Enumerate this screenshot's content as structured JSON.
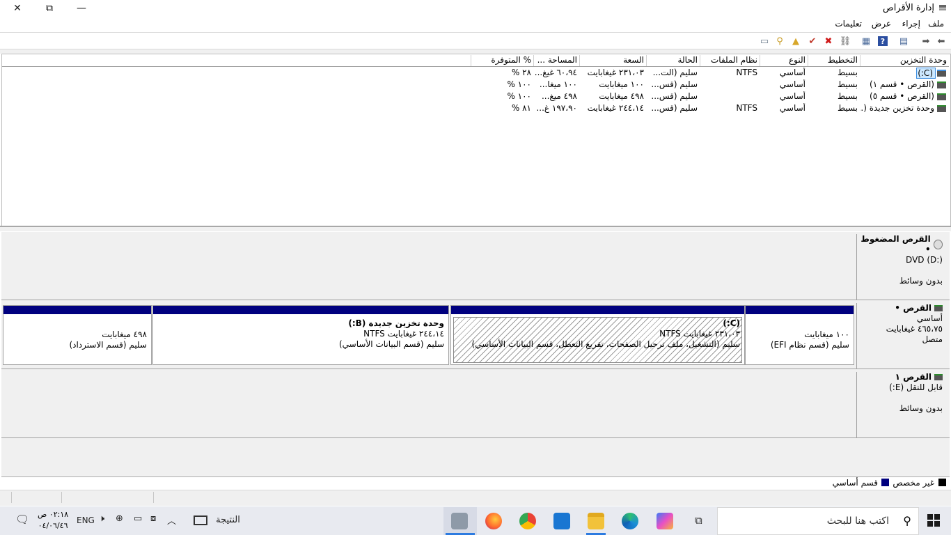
{
  "window": {
    "title": "إدارة الأقراص",
    "icon": "disk-management-icon",
    "controls": {
      "minimize": "—",
      "restore": "⧉",
      "close": "✕"
    }
  },
  "menu": [
    "ملف",
    "إجراء",
    "عرض",
    "تعليمات"
  ],
  "toolbar": [
    "back-icon",
    "forward-icon",
    "properties-icon",
    "help-icon",
    "show-hide-icon",
    "connect-icon",
    "delete-icon",
    "check-icon",
    "folder-up-icon",
    "search-icon",
    "console-icon"
  ],
  "volume_list": {
    "columns": [
      "وحدة التخزين",
      "التخطيط",
      "النوع",
      "نظام الملفات",
      "الحالة",
      "السعة",
      "المساحة ...",
      "% المتوفرة"
    ],
    "rows": [
      [
        "(C:)",
        "بسيط",
        "أساسي",
        "NTFS",
        "سليم (الت...",
        "٢٣١،٠٣ غيغابايت",
        "٦٠،٩٤ غيغ...",
        "٢٨ %"
      ],
      [
        "(القرص • قسم ١)",
        "بسيط",
        "أساسي",
        "",
        "سليم (قس...",
        "١٠٠ ميغابايت",
        "١٠٠ ميغا...",
        "١٠٠ %"
      ],
      [
        "(القرص • قسم ٥)",
        "بسيط",
        "أساسي",
        "",
        "سليم (قس...",
        "٤٩٨ ميغابايت",
        "٤٩٨ ميغ...",
        "١٠٠ %"
      ],
      [
        "وحدة تخزين جديدة (...",
        "بسيط",
        "أساسي",
        "NTFS",
        "سليم (قس...",
        "٢٤٤،١٤ غيغابايت",
        "١٩٧،٩٠ غ...",
        "٨١ %"
      ]
    ]
  },
  "disks": {
    "dvd": {
      "name": "القرص المضغوط •",
      "type": "DVD (D:)",
      "media": "بدون وسائط"
    },
    "disk0": {
      "name": "القرص •",
      "type": "أساسي",
      "size": "٤٦٥،٧٥ غيغابايت",
      "status": "متصل",
      "partitions": [
        {
          "title": "",
          "size": "١٠٠ ميغابايت",
          "status": "سليم (قسم نظام EFI)"
        },
        {
          "title": "(C:)",
          "size": "٢٣١،٠٣ غيغابايت NTFS",
          "status": "سليم (التشغيل، ملف ترحيل الصفحات، تفريغ التعطل، قسم البيانات الأساسي)"
        },
        {
          "title": "وحدة تخزين جديدة  (B:)",
          "size": "٢٤٤،١٤ غيغابايت NTFS",
          "status": "سليم (قسم البيانات الأساسي)"
        },
        {
          "title": "",
          "size": "٤٩٨ ميغابايت",
          "status": "سليم (قسم الاسترداد)"
        }
      ]
    },
    "disk1": {
      "name": "القرص ١",
      "type": "قابل للنقل (E:)",
      "media": "بدون وسائط"
    }
  },
  "legend": [
    {
      "label": "غير مخصص",
      "color": "#000000"
    },
    {
      "label": "قسم أساسي",
      "color": "#00007f"
    }
  ],
  "taskbar": {
    "search_placeholder": "اكتب هنا للبحث",
    "result_label": "النتيجة",
    "language": "ENG",
    "time": "٠٢:١٨ ص",
    "date": "٠٤/٠٦/٤٦",
    "apps": [
      "task-view-icon",
      "copilot-icon",
      "edge-icon",
      "file-explorer-icon",
      "mail-icon",
      "chrome-icon",
      "firefox-icon",
      "disk-management-icon"
    ]
  },
  "colors": {
    "primary_partition": "#00007f",
    "selection": "#cce8ff",
    "taskbar": "#e8eaf0"
  }
}
